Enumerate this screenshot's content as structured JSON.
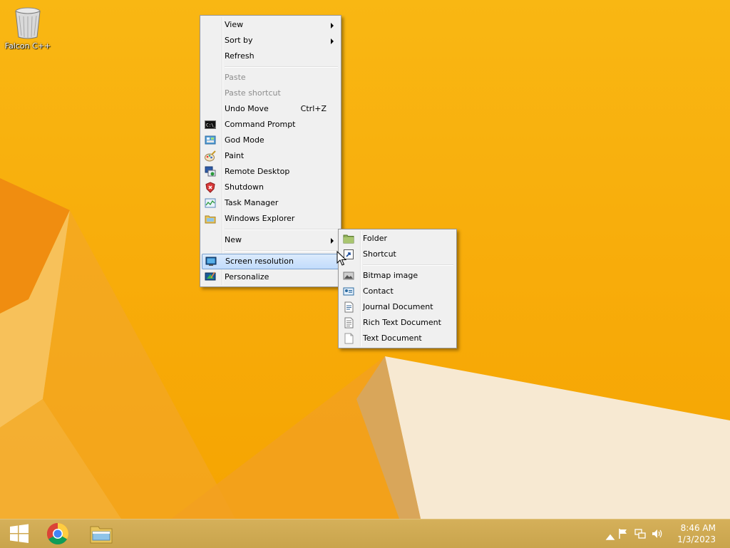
{
  "desktop": {
    "icon_label": "Falcon C++"
  },
  "context_menu": {
    "view": "View",
    "sort_by": "Sort by",
    "refresh": "Refresh",
    "paste": "Paste",
    "paste_shortcut": "Paste shortcut",
    "undo_move": "Undo Move",
    "undo_shortcut": "Ctrl+Z",
    "command_prompt": "Command Prompt",
    "god_mode": "God Mode",
    "paint": "Paint",
    "remote_desktop": "Remote Desktop",
    "shutdown": "Shutdown",
    "task_manager": "Task Manager",
    "windows_explorer": "Windows Explorer",
    "new": "New",
    "screen_resolution": "Screen resolution",
    "personalize": "Personalize"
  },
  "new_submenu": {
    "folder": "Folder",
    "shortcut": "Shortcut",
    "bitmap_image": "Bitmap image",
    "contact": "Contact",
    "journal_document": "Journal Document",
    "rich_text_document": "Rich Text Document",
    "text_document": "Text Document"
  },
  "taskbar": {
    "pinned": [
      "start-icon",
      "chrome-icon",
      "file-explorer-icon"
    ]
  },
  "tray": {
    "time": "8:46 AM",
    "date": "1/3/2023"
  },
  "colors": {
    "wallpaper": "#f8ad0b",
    "highlight": "#c1dbfc",
    "taskbar": "#cfaa52"
  }
}
